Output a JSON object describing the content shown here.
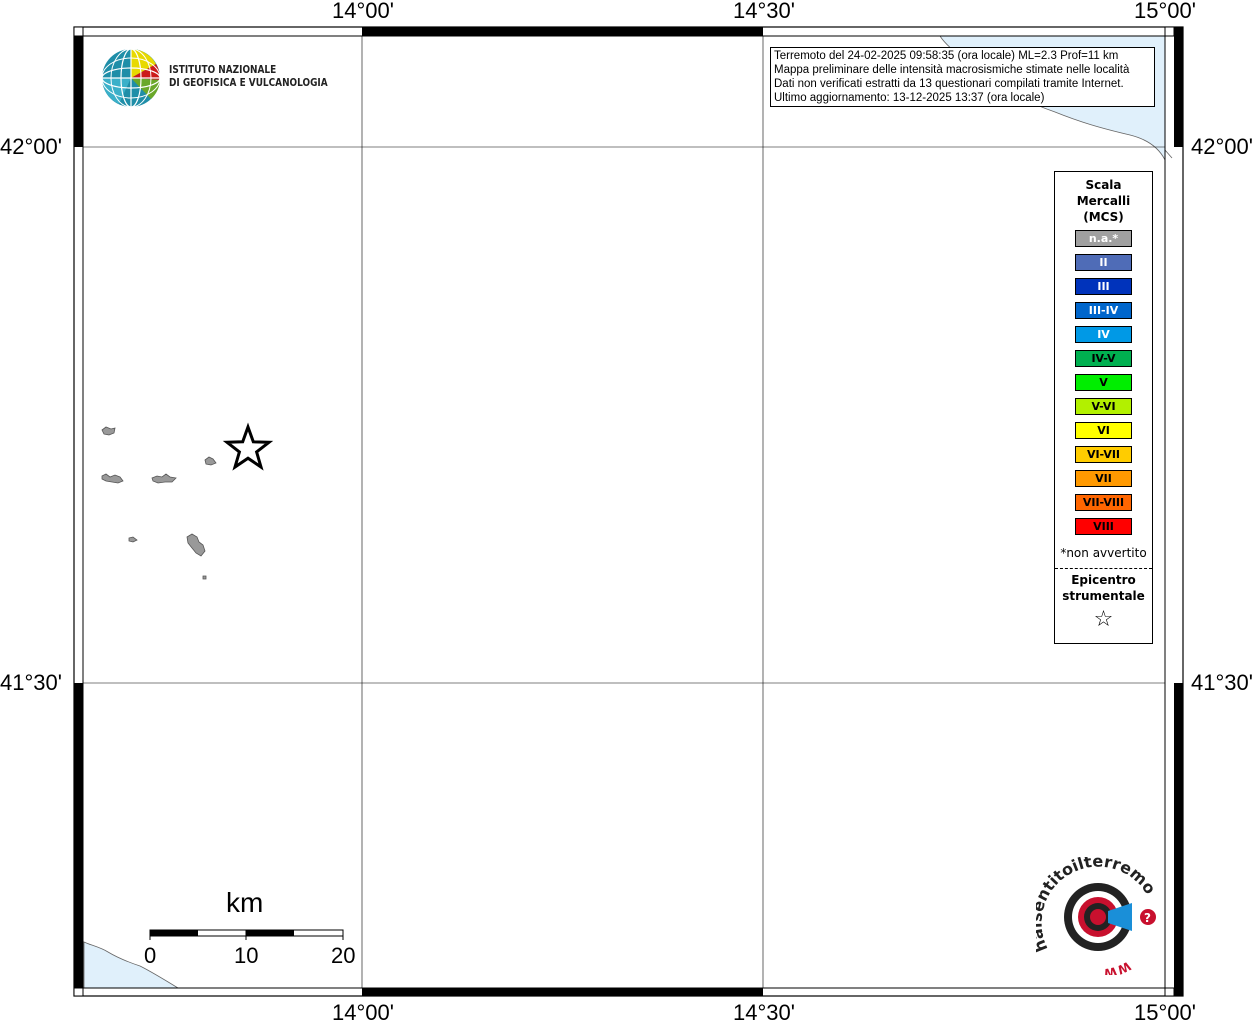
{
  "map": {
    "lon_ticks": [
      "14°00'",
      "14°30'",
      "15°00'"
    ],
    "lat_ticks": [
      "42°00'",
      "41°30'"
    ],
    "colors": {
      "sea": "#e0f0fb",
      "coast": "#666666",
      "grid": "#000000",
      "locality": "#888888"
    }
  },
  "logo": {
    "line1": "ISTITUTO NAZIONALE",
    "line2": "DI GEOFISICA E VULCANOLOGIA",
    "icon": "ingv-globe-icon"
  },
  "info": {
    "line1": "Terremoto del 24-02-2025 09:58:35 (ora locale) ML=2.3 Prof=11 km",
    "line2": "Mappa preliminare delle intensità macrosismiche stimate nelle località",
    "line3": "Dati non verificati estratti da 13 questionari compilati tramite Internet.",
    "line4": "Ultimo aggiornamento: 13-12-2025 13:37 (ora locale)"
  },
  "legend": {
    "title1": "Scala",
    "title2": "Mercalli",
    "title3": "(MCS)",
    "items": [
      {
        "label": "n.a.*",
        "color": "#a0a0a0",
        "text_color": "#ffffff"
      },
      {
        "label": "II",
        "color": "#4f6cb7",
        "text_color": "#ffffff"
      },
      {
        "label": "III",
        "color": "#0033bb",
        "text_color": "#ffffff"
      },
      {
        "label": "III-IV",
        "color": "#0066cc",
        "text_color": "#ffffff"
      },
      {
        "label": "IV",
        "color": "#0099e6",
        "text_color": "#ffffff"
      },
      {
        "label": "IV-V",
        "color": "#00b050",
        "text_color": "#000000"
      },
      {
        "label": "V",
        "color": "#00ee00",
        "text_color": "#000000"
      },
      {
        "label": "V-VI",
        "color": "#b2f000",
        "text_color": "#000000"
      },
      {
        "label": "VI",
        "color": "#ffff00",
        "text_color": "#000000"
      },
      {
        "label": "VI-VII",
        "color": "#ffcc00",
        "text_color": "#000000"
      },
      {
        "label": "VII",
        "color": "#ff9900",
        "text_color": "#000000"
      },
      {
        "label": "VII-VIII",
        "color": "#ff6600",
        "text_color": "#000000"
      },
      {
        "label": "VIII",
        "color": "#ff0000",
        "text_color": "#000000"
      }
    ],
    "note": "*non avvertito",
    "epicenter_title1": "Epicentro",
    "epicenter_title2": "strumentale",
    "epicenter_symbol": "☆"
  },
  "scale_bar": {
    "unit": "km",
    "labels": [
      "0",
      "10",
      "20"
    ]
  },
  "badge": {
    "text": "haisentitoilterremoto.it",
    "url_text": "WWW.",
    "icon": "haisentito-logo-icon"
  }
}
